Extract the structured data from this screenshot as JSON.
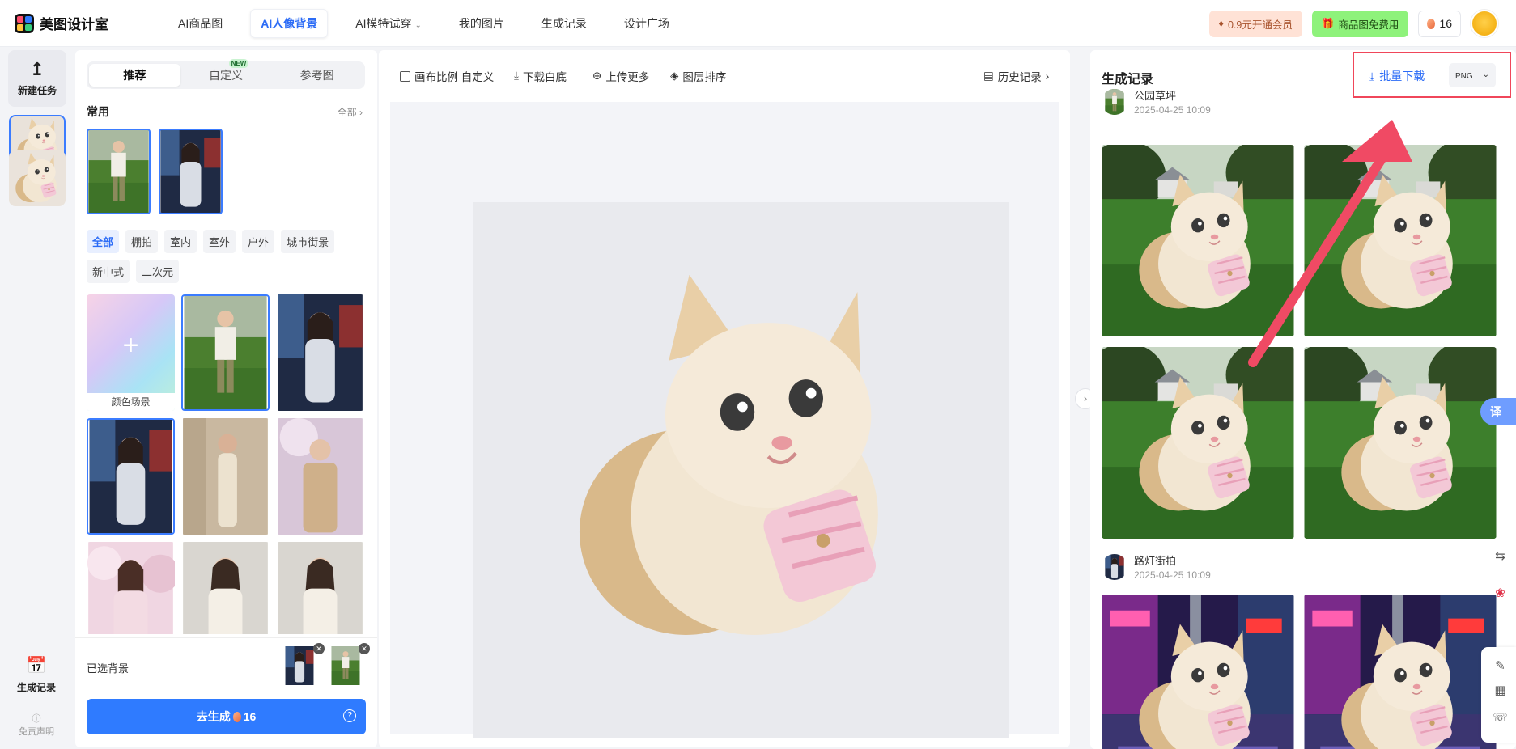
{
  "app": {
    "name": "美图设计室"
  },
  "nav": {
    "items": [
      {
        "label": "AI商品图",
        "active": false
      },
      {
        "label": "AI人像背景",
        "active": true
      },
      {
        "label": "AI模特试穿",
        "active": false,
        "dropdown": true
      },
      {
        "label": "我的图片",
        "active": false
      },
      {
        "label": "生成记录",
        "active": false
      },
      {
        "label": "设计广场",
        "active": false
      }
    ]
  },
  "header_right": {
    "vip_label": "0.9元开通会员",
    "free_label": "商品图免费用",
    "credits": "16"
  },
  "rail": {
    "new_task": "新建任务",
    "history": "生成记录",
    "disclaimer": "免责声明"
  },
  "left_panel": {
    "tabs": [
      {
        "label": "推荐",
        "active": true
      },
      {
        "label": "自定义",
        "active": false,
        "badge": "NEW"
      },
      {
        "label": "参考图",
        "active": false
      }
    ],
    "section_title": "常用",
    "section_all": "全部",
    "categories": [
      {
        "label": "全部",
        "active": true
      },
      {
        "label": "棚拍",
        "active": false
      },
      {
        "label": "室内",
        "active": false
      },
      {
        "label": "室外",
        "active": false
      },
      {
        "label": "户外",
        "active": false
      },
      {
        "label": "城市街景",
        "active": false
      },
      {
        "label": "新中式",
        "active": false
      },
      {
        "label": "二次元",
        "active": false
      }
    ],
    "color_scene_label": "颜色场景",
    "selected_label": "已选背景",
    "generate_label": "去生成",
    "generate_cost": "16"
  },
  "center": {
    "tools": [
      {
        "label": "画布比例 自定义",
        "icon": "checkbox-icon"
      },
      {
        "label": "下载白底",
        "icon": "download-icon"
      },
      {
        "label": "上传更多",
        "icon": "plus-circle-icon"
      },
      {
        "label": "图层排序",
        "icon": "layers-icon"
      }
    ],
    "history_label": "历史记录"
  },
  "right_panel": {
    "title": "生成记录",
    "batch_download": "批量下载",
    "format": "PNG",
    "groups": [
      {
        "title": "公园草坪",
        "time": "2025-04-25 10:09"
      },
      {
        "title": "路灯街拍",
        "time": "2025-04-25 10:09"
      }
    ]
  },
  "side_tools": {
    "translate": "译"
  },
  "colors": {
    "accent": "#2f7bff",
    "highlight_box": "#f0465a",
    "vip_bg": "#ffe2d6",
    "free_bg": "#8ef27b"
  }
}
